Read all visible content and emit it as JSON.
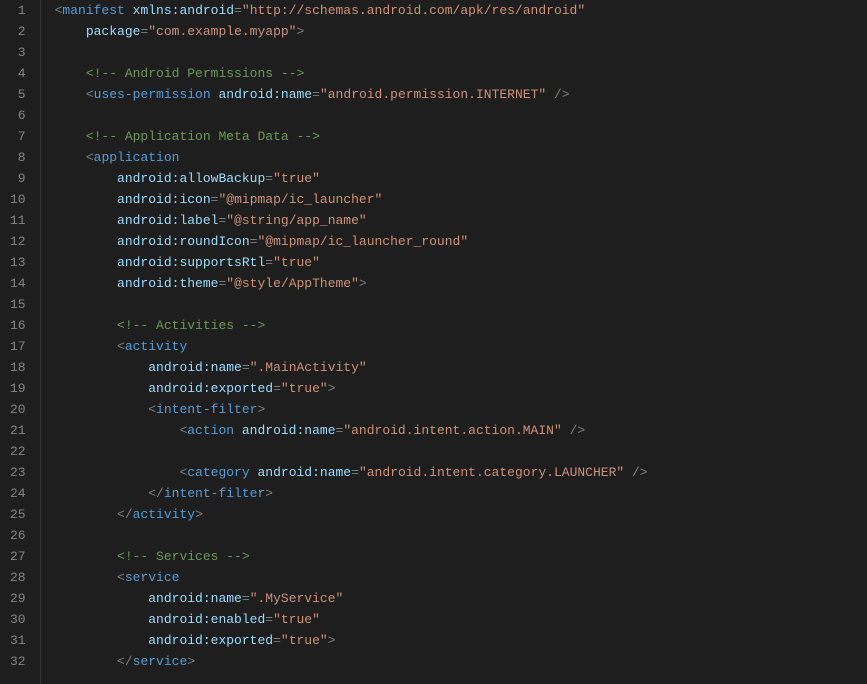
{
  "lineCount": 32,
  "lines": [
    {
      "indent": 0,
      "tokens": [
        {
          "t": "p",
          "v": "<"
        },
        {
          "t": "t",
          "v": "manifest"
        },
        {
          "t": "p",
          "v": " "
        },
        {
          "t": "ns",
          "v": "xmlns:"
        },
        {
          "t": "an",
          "v": "android"
        },
        {
          "t": "p",
          "v": "="
        },
        {
          "t": "s",
          "v": "\"http://schemas.android.com/apk/res/android\""
        }
      ]
    },
    {
      "indent": 1,
      "tokens": [
        {
          "t": "an",
          "v": "package"
        },
        {
          "t": "p",
          "v": "="
        },
        {
          "t": "s",
          "v": "\"com.example.myapp\""
        },
        {
          "t": "p",
          "v": ">"
        }
      ]
    },
    {
      "indent": 0,
      "tokens": []
    },
    {
      "indent": 1,
      "tokens": [
        {
          "t": "c",
          "v": "<!-- Android Permissions -->"
        }
      ]
    },
    {
      "indent": 1,
      "tokens": [
        {
          "t": "p",
          "v": "<"
        },
        {
          "t": "t",
          "v": "uses-permission"
        },
        {
          "t": "p",
          "v": " "
        },
        {
          "t": "ns",
          "v": "android:"
        },
        {
          "t": "an",
          "v": "name"
        },
        {
          "t": "p",
          "v": "="
        },
        {
          "t": "s",
          "v": "\"android.permission.INTERNET\""
        },
        {
          "t": "p",
          "v": " />"
        }
      ]
    },
    {
      "indent": 0,
      "tokens": []
    },
    {
      "indent": 1,
      "tokens": [
        {
          "t": "c",
          "v": "<!-- Application Meta Data -->"
        }
      ]
    },
    {
      "indent": 1,
      "tokens": [
        {
          "t": "p",
          "v": "<"
        },
        {
          "t": "t",
          "v": "application"
        }
      ]
    },
    {
      "indent": 2,
      "tokens": [
        {
          "t": "ns",
          "v": "android:"
        },
        {
          "t": "an",
          "v": "allowBackup"
        },
        {
          "t": "p",
          "v": "="
        },
        {
          "t": "s",
          "v": "\"true\""
        }
      ]
    },
    {
      "indent": 2,
      "tokens": [
        {
          "t": "ns",
          "v": "android:"
        },
        {
          "t": "an",
          "v": "icon"
        },
        {
          "t": "p",
          "v": "="
        },
        {
          "t": "s",
          "v": "\"@mipmap/ic_launcher\""
        }
      ]
    },
    {
      "indent": 2,
      "tokens": [
        {
          "t": "ns",
          "v": "android:"
        },
        {
          "t": "an",
          "v": "label"
        },
        {
          "t": "p",
          "v": "="
        },
        {
          "t": "s",
          "v": "\"@string/app_name\""
        }
      ]
    },
    {
      "indent": 2,
      "tokens": [
        {
          "t": "ns",
          "v": "android:"
        },
        {
          "t": "an",
          "v": "roundIcon"
        },
        {
          "t": "p",
          "v": "="
        },
        {
          "t": "s",
          "v": "\"@mipmap/ic_launcher_round\""
        }
      ]
    },
    {
      "indent": 2,
      "tokens": [
        {
          "t": "ns",
          "v": "android:"
        },
        {
          "t": "an",
          "v": "supportsRtl"
        },
        {
          "t": "p",
          "v": "="
        },
        {
          "t": "s",
          "v": "\"true\""
        }
      ]
    },
    {
      "indent": 2,
      "tokens": [
        {
          "t": "ns",
          "v": "android:"
        },
        {
          "t": "an",
          "v": "theme"
        },
        {
          "t": "p",
          "v": "="
        },
        {
          "t": "s",
          "v": "\"@style/AppTheme\""
        },
        {
          "t": "p",
          "v": ">"
        }
      ]
    },
    {
      "indent": 0,
      "tokens": []
    },
    {
      "indent": 2,
      "tokens": [
        {
          "t": "c",
          "v": "<!-- Activities -->"
        }
      ]
    },
    {
      "indent": 2,
      "tokens": [
        {
          "t": "p",
          "v": "<"
        },
        {
          "t": "t",
          "v": "activity"
        }
      ]
    },
    {
      "indent": 3,
      "tokens": [
        {
          "t": "ns",
          "v": "android:"
        },
        {
          "t": "an",
          "v": "name"
        },
        {
          "t": "p",
          "v": "="
        },
        {
          "t": "s",
          "v": "\".MainActivity\""
        }
      ]
    },
    {
      "indent": 3,
      "tokens": [
        {
          "t": "ns",
          "v": "android:"
        },
        {
          "t": "an",
          "v": "exported"
        },
        {
          "t": "p",
          "v": "="
        },
        {
          "t": "s",
          "v": "\"true\""
        },
        {
          "t": "p",
          "v": ">"
        }
      ]
    },
    {
      "indent": 3,
      "tokens": [
        {
          "t": "p",
          "v": "<"
        },
        {
          "t": "t",
          "v": "intent-filter"
        },
        {
          "t": "p",
          "v": ">"
        }
      ]
    },
    {
      "indent": 4,
      "tokens": [
        {
          "t": "p",
          "v": "<"
        },
        {
          "t": "t",
          "v": "action"
        },
        {
          "t": "p",
          "v": " "
        },
        {
          "t": "ns",
          "v": "android:"
        },
        {
          "t": "an",
          "v": "name"
        },
        {
          "t": "p",
          "v": "="
        },
        {
          "t": "s",
          "v": "\"android.intent.action.MAIN\""
        },
        {
          "t": "p",
          "v": " />"
        }
      ]
    },
    {
      "indent": 0,
      "tokens": []
    },
    {
      "indent": 4,
      "tokens": [
        {
          "t": "p",
          "v": "<"
        },
        {
          "t": "t",
          "v": "category"
        },
        {
          "t": "p",
          "v": " "
        },
        {
          "t": "ns",
          "v": "android:"
        },
        {
          "t": "an",
          "v": "name"
        },
        {
          "t": "p",
          "v": "="
        },
        {
          "t": "s",
          "v": "\"android.intent.category.LAUNCHER\""
        },
        {
          "t": "p",
          "v": " />"
        }
      ]
    },
    {
      "indent": 3,
      "tokens": [
        {
          "t": "p",
          "v": "</"
        },
        {
          "t": "t",
          "v": "intent-filter"
        },
        {
          "t": "p",
          "v": ">"
        }
      ]
    },
    {
      "indent": 2,
      "tokens": [
        {
          "t": "p",
          "v": "</"
        },
        {
          "t": "t",
          "v": "activity"
        },
        {
          "t": "p",
          "v": ">"
        }
      ]
    },
    {
      "indent": 0,
      "tokens": []
    },
    {
      "indent": 2,
      "tokens": [
        {
          "t": "c",
          "v": "<!-- Services -->"
        }
      ]
    },
    {
      "indent": 2,
      "tokens": [
        {
          "t": "p",
          "v": "<"
        },
        {
          "t": "t",
          "v": "service"
        }
      ]
    },
    {
      "indent": 3,
      "tokens": [
        {
          "t": "ns",
          "v": "android:"
        },
        {
          "t": "an",
          "v": "name"
        },
        {
          "t": "p",
          "v": "="
        },
        {
          "t": "s",
          "v": "\".MyService\""
        }
      ]
    },
    {
      "indent": 3,
      "tokens": [
        {
          "t": "ns",
          "v": "android:"
        },
        {
          "t": "an",
          "v": "enabled"
        },
        {
          "t": "p",
          "v": "="
        },
        {
          "t": "s",
          "v": "\"true\""
        }
      ]
    },
    {
      "indent": 3,
      "tokens": [
        {
          "t": "ns",
          "v": "android:"
        },
        {
          "t": "an",
          "v": "exported"
        },
        {
          "t": "p",
          "v": "="
        },
        {
          "t": "s",
          "v": "\"true\""
        },
        {
          "t": "p",
          "v": ">"
        }
      ]
    },
    {
      "indent": 2,
      "tokens": [
        {
          "t": "p",
          "v": "</"
        },
        {
          "t": "t",
          "v": "service"
        },
        {
          "t": "p",
          "v": ">"
        }
      ]
    }
  ]
}
